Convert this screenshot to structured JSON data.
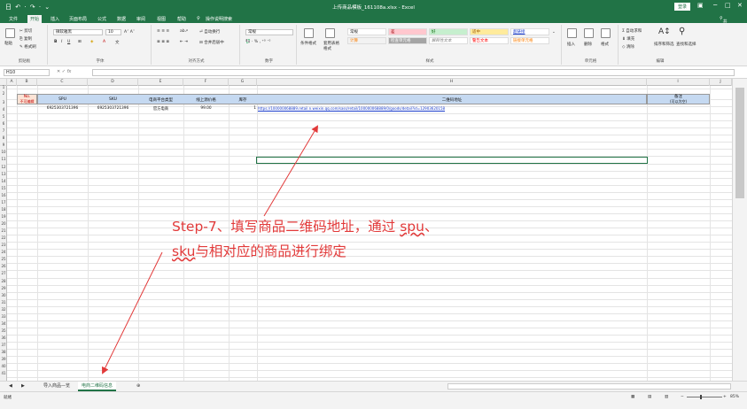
{
  "titlebar": {
    "title": "上传商品模板_161108a.xlsx - Excel",
    "login": "登录",
    "quick_access": "日 ↶ · ↷ · ⌄"
  },
  "menu": {
    "items": [
      "文件",
      "开始",
      "插入",
      "页面布局",
      "公式",
      "数据",
      "审阅",
      "视图",
      "帮助",
      "操作说明搜索"
    ],
    "share": "共享"
  },
  "ribbon": {
    "clipboard": {
      "paste": "粘贴",
      "cut": "剪切",
      "copy": "复制",
      "format_painter": "格式刷",
      "caption": "剪贴板"
    },
    "font": {
      "name": "微软雅黑",
      "size": "10",
      "caption": "字体",
      "bold": "B",
      "italic": "I",
      "underline": "U"
    },
    "alignment": {
      "wrap": "自动换行",
      "merge": "合并后居中",
      "caption": "对齐方式"
    },
    "number": {
      "format": "常规",
      "caption": "数字"
    },
    "styles": {
      "conditional": "条件格式",
      "table": "套用表格格式",
      "normal": "常规",
      "bad": "差",
      "good": "好",
      "neutral": "适中",
      "hyperlink": "超链接",
      "calc": "计算",
      "check": "检查单元格",
      "explain": "解释性文本",
      "warn": "警告文本",
      "linked": "链接单元格",
      "caption": "样式"
    },
    "cells": {
      "insert": "插入",
      "delete": "删除",
      "format": "格式",
      "caption": "单元格"
    },
    "editing": {
      "autosum": "自动求和",
      "fill": "填充",
      "clear": "清除",
      "sort": "排序和筛选",
      "find": "查找和选择",
      "caption": "编辑"
    }
  },
  "formula_bar": {
    "name_box": "H10",
    "fx": "fx",
    "value": ""
  },
  "columns": [
    "A",
    "B",
    "C",
    "D",
    "E",
    "F",
    "G",
    "H",
    "I",
    "J"
  ],
  "header_row": {
    "no": "No.",
    "no_note": "不可编辑",
    "spu": "SPU",
    "sku": "SKU",
    "platform": "电商平台类型",
    "price": "线上源价格",
    "stock": "库存",
    "qr": "二维码地址",
    "remark": "备注",
    "remark_note": "(可以为空)"
  },
  "data_row": {
    "spu": "6925303721396",
    "sku": "6925303721396",
    "platform": "官方电商",
    "price": "99.00",
    "stock": "1",
    "qr": "https://100000068889.retail.n.weixin.qq.com/sass/retail/100000068889/0/goods/detail?id=12903620158"
  },
  "sheets": [
    "导入商品—览",
    "电商二维码信息"
  ],
  "active_sheet": 1,
  "add_sheet": "⊕",
  "status": {
    "ready": "就绪",
    "zoom": "85%"
  },
  "annotation": {
    "prefix": "Step-7、填写商品二维码地址，通过 ",
    "spu": "spu",
    "sep": "、",
    "sku": "sku",
    "suffix": "与相对应的商品进行绑定"
  },
  "colors": {
    "excel_green": "#217346",
    "annotation_red": "#e23a3a",
    "header_fill": "#c5d9f1",
    "no_fill": "#fce4d6"
  }
}
